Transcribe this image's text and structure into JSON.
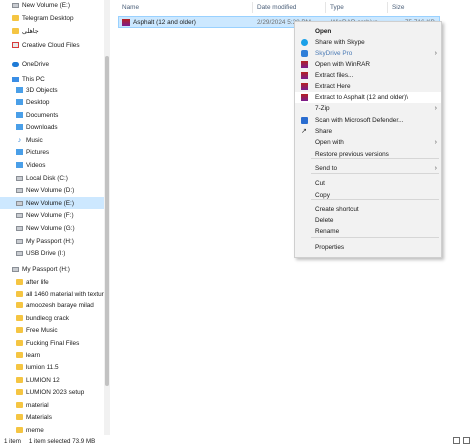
{
  "sidebar": {
    "items": [
      {
        "label": "New Volume (E:)",
        "icon": "drive-icon",
        "kind": "drive",
        "indent": 12
      },
      {
        "label": "Telegram Desktop",
        "icon": "folder-icon",
        "kind": "folder",
        "indent": 12
      },
      {
        "label": "جاهلی",
        "icon": "folder-icon",
        "kind": "folder",
        "indent": 12
      },
      {
        "label": "Creative Cloud Files",
        "icon": "creative-cloud-icon",
        "kind": "cc",
        "indent": 12
      },
      {
        "label": "OneDrive",
        "icon": "cloud-icon",
        "kind": "cloud",
        "indent": 12
      },
      {
        "label": "This PC",
        "icon": "pc-icon",
        "kind": "pc",
        "indent": 12
      },
      {
        "label": "3D Objects",
        "icon": "cube-icon",
        "kind": "blue",
        "indent": 16
      },
      {
        "label": "Desktop",
        "icon": "desktop-icon",
        "kind": "blue",
        "indent": 16
      },
      {
        "label": "Documents",
        "icon": "document-icon",
        "kind": "blue",
        "indent": 16
      },
      {
        "label": "Downloads",
        "icon": "download-icon",
        "kind": "blue",
        "indent": 16
      },
      {
        "label": "Music",
        "icon": "music-icon",
        "kind": "music",
        "indent": 16
      },
      {
        "label": "Pictures",
        "icon": "picture-icon",
        "kind": "blue",
        "indent": 16
      },
      {
        "label": "Videos",
        "icon": "video-icon",
        "kind": "blue",
        "indent": 16
      },
      {
        "label": "Local Disk (C:)",
        "icon": "drive-icon",
        "kind": "drive",
        "indent": 16
      },
      {
        "label": "New Volume (D:)",
        "icon": "drive-icon",
        "kind": "drive",
        "indent": 16
      },
      {
        "label": "New Volume (E:)",
        "icon": "drive-icon",
        "kind": "drive",
        "indent": 16,
        "selected": true
      },
      {
        "label": "New Volume (F:)",
        "icon": "drive-icon",
        "kind": "drive",
        "indent": 16
      },
      {
        "label": "New Volume (G:)",
        "icon": "drive-icon",
        "kind": "drive",
        "indent": 16
      },
      {
        "label": "My Passport (H:)",
        "icon": "drive-icon",
        "kind": "drive",
        "indent": 16
      },
      {
        "label": "USB Drive (I:)",
        "icon": "drive-icon",
        "kind": "drive",
        "indent": 16
      },
      {
        "label": "My Passport (H:)",
        "icon": "drive-icon",
        "kind": "drive",
        "indent": 12
      },
      {
        "label": "after life",
        "icon": "folder-icon",
        "kind": "folder",
        "indent": 16
      },
      {
        "label": "all 1460 material with textur",
        "icon": "folder-icon",
        "kind": "folder",
        "indent": 16
      },
      {
        "label": "amoozesh baraye milad",
        "icon": "folder-icon",
        "kind": "folder",
        "indent": 16
      },
      {
        "label": "bundlecg crack",
        "icon": "folder-icon",
        "kind": "folder",
        "indent": 16
      },
      {
        "label": "Free Music",
        "icon": "folder-icon",
        "kind": "folder",
        "indent": 16
      },
      {
        "label": "Fucking Final Files",
        "icon": "folder-icon",
        "kind": "folder",
        "indent": 16
      },
      {
        "label": "learn",
        "icon": "folder-icon",
        "kind": "folder",
        "indent": 16
      },
      {
        "label": "lumion 11.5",
        "icon": "folder-icon",
        "kind": "folder",
        "indent": 16
      },
      {
        "label": "LUMION 12",
        "icon": "folder-icon",
        "kind": "folder",
        "indent": 16
      },
      {
        "label": "LUMION 2023 setup",
        "icon": "folder-icon",
        "kind": "folder",
        "indent": 16
      },
      {
        "label": "material",
        "icon": "folder-icon",
        "kind": "folder",
        "indent": 16
      },
      {
        "label": "Materials",
        "icon": "folder-icon",
        "kind": "folder",
        "indent": 16
      },
      {
        "label": "meme",
        "icon": "folder-icon",
        "kind": "folder",
        "indent": 16
      }
    ]
  },
  "columns": {
    "name": "Name",
    "date": "Date modified",
    "type": "Type",
    "size": "Size"
  },
  "file": {
    "name": "Asphalt (12 and older)",
    "date": "2/29/2024 5:38 PM",
    "type": "WinRAR archive",
    "size": "75,716 KB",
    "icon": "winrar-archive-icon"
  },
  "context_menu": {
    "items": [
      {
        "label": "Open",
        "bold": true,
        "icon": ""
      },
      {
        "label": "Share with Skype",
        "icon": "skype-icon"
      },
      {
        "label": "SkyDrive Pro",
        "icon": "skydrive-icon",
        "arrow": true,
        "muted": true
      },
      {
        "label": "Open with WinRAR",
        "icon": "winrar-icon"
      },
      {
        "label": "Extract files...",
        "icon": "winrar-icon"
      },
      {
        "label": "Extract Here",
        "icon": "winrar-icon"
      },
      {
        "label": "Extract to Asphalt (12 and older)\\",
        "icon": "winrar-icon",
        "highlight": true
      },
      {
        "label": "7-Zip",
        "icon": "",
        "arrow": true
      },
      {
        "label": "Scan with Microsoft Defender...",
        "icon": "defender-icon"
      },
      {
        "label": "Share",
        "icon": "share-icon"
      },
      {
        "label": "Open with",
        "icon": "",
        "arrow": true
      },
      {
        "label": "Restore previous versions",
        "icon": ""
      },
      {
        "label": "Send to",
        "icon": "",
        "arrow": true
      },
      {
        "label": "Cut",
        "icon": ""
      },
      {
        "label": "Copy",
        "icon": ""
      },
      {
        "label": "Create shortcut",
        "icon": ""
      },
      {
        "label": "Delete",
        "icon": ""
      },
      {
        "label": "Rename",
        "icon": ""
      },
      {
        "label": "Properties",
        "icon": ""
      }
    ]
  },
  "status_bar": {
    "count": "1 item",
    "selected": "1 item selected  73.9 MB"
  },
  "colors": {
    "selection": "#cce8ff",
    "selection_border": "#99d1ff",
    "menu_bg": "#f2f2f2",
    "folder": "#f5c542"
  }
}
